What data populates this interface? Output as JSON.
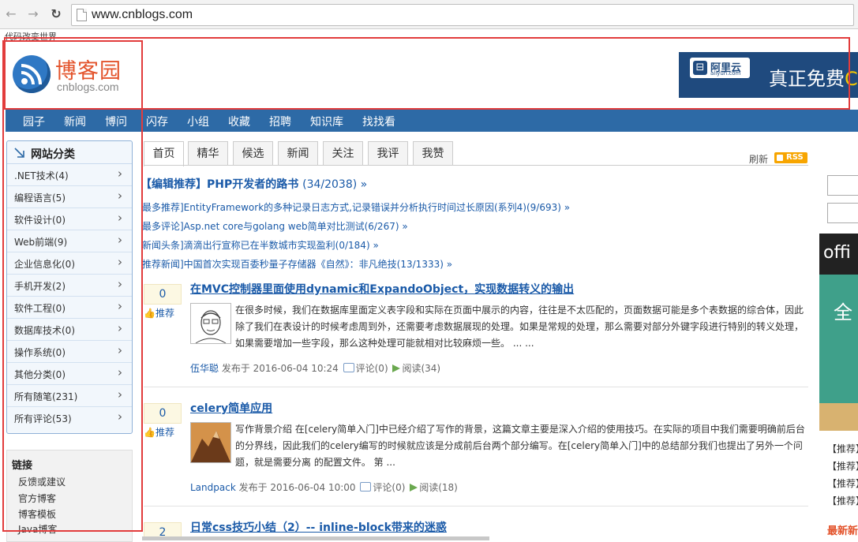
{
  "browser": {
    "url": "www.cnblogs.com",
    "back_icon": "←",
    "forward_icon": "→",
    "reload_icon": "↻"
  },
  "header": {
    "slogan": "代码改变世界",
    "logo_name": "博客园",
    "logo_domain": "cnblogs.com",
    "ad": {
      "brand": "阿里云",
      "brand_sub": "aliyun.com",
      "text": "真正免费",
      "text_tail": "C"
    }
  },
  "nav": [
    "园子",
    "新闻",
    "博问",
    "闪存",
    "小组",
    "收藏",
    "招聘",
    "知识库",
    "找找看"
  ],
  "sidebar": {
    "title": "网站分类",
    "categories": [
      ".NET技术(4)",
      "编程语言(5)",
      "软件设计(0)",
      "Web前端(9)",
      "企业信息化(0)",
      "手机开发(2)",
      "软件工程(0)",
      "数据库技术(0)",
      "操作系统(0)",
      "其他分类(0)",
      "所有随笔(231)",
      "所有评论(53)"
    ],
    "chevron": "›",
    "links_title": "链接",
    "links": [
      "反馈或建议",
      "官方博客",
      "博客模板",
      "Java博客"
    ]
  },
  "tabs": [
    "首页",
    "精华",
    "候选",
    "新闻",
    "关注",
    "我评",
    "我赞"
  ],
  "toolbar": {
    "refresh": "刷新",
    "rss": "RSS"
  },
  "headlines": {
    "main": "【编辑推荐】PHP开发者的路书",
    "main_count": "(34/2038) »",
    "items": [
      "最多推荐]EntityFramework的多种记录日志方式,记录错误并分析执行时间过长原因(系列4)(9/693) »",
      "最多评论]Asp.net core与golang web简单对比测试(6/267) »",
      "新闻头条]滴滴出行宣称已在半数城市实现盈利(0/184) »",
      "推荐新闻]中国首次实现百委秒量子存储器《自然》：非凡绝技(13/1333) »"
    ]
  },
  "posts": [
    {
      "votes": "0",
      "recommend": "推荐",
      "title": "在MVC控制器里面使用dynamic和ExpandoObject，实现数据转义的输出",
      "summary": "在很多时候，我们在数据库里面定义表字段和实际在页面中展示的内容，往往是不太匹配的，页面数据可能是多个表数据的综合体，因此除了我们在表设计的时候考虑周到外，还需要考虑数据展现的处理。如果是常规的处理，那么需要对部分外键字段进行特别的转义处理，如果需要增加一些字段，那么这种处理可能就相对比较麻烦一些。 ... ...",
      "author": "伍华聪",
      "published": "发布于 2016-06-04 10:24",
      "comments": "评论(0)",
      "reads": "阅读(34)"
    },
    {
      "votes": "0",
      "recommend": "推荐",
      "title": "celery简单应用",
      "summary": "写作背景介绍 在[celery简单入门]中已经介绍了写作的背景，这篇文章主要是深入介绍的使用技巧。在实际的项目中我们需要明确前后台的分界线，因此我们的celery编写的时候就应该是分成前后台两个部分编写。在[celery简单入门]中的总结部分我们也提出了另外一个问题，就是需要分离 的配置文件。 第 ...",
      "author": "Landpack",
      "published": "发布于 2016-06-04 10:00",
      "comments": "评论(0)",
      "reads": "阅读(18)"
    },
    {
      "votes": "2",
      "title": "日常css技巧小结（2）-- inline-block带来的迷惑"
    }
  ],
  "right": {
    "ad_top": "offi",
    "ad_text": "全",
    "links": [
      "【推荐】",
      "【推荐】",
      "【推荐】",
      "【推荐】"
    ],
    "news": "最新新"
  }
}
